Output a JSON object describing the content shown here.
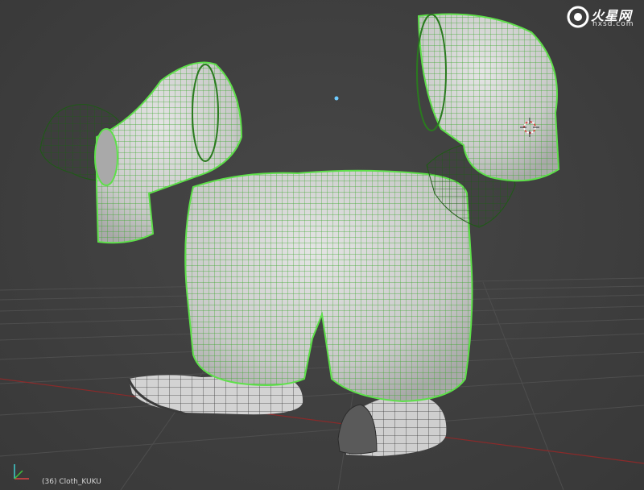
{
  "viewport": {
    "object_info": "(36) Cloth_KUKU",
    "background_color": "#3d3d3d",
    "wire_color": "#4dd63a",
    "mesh_color": "#d6d6d6"
  },
  "watermark": {
    "logo_text": "火星网",
    "sub_text": "hxsd.com"
  },
  "icons": {
    "cursor": "3d-cursor-icon",
    "gizmo": "axis-gizmo-icon",
    "light": "light-point-icon"
  }
}
